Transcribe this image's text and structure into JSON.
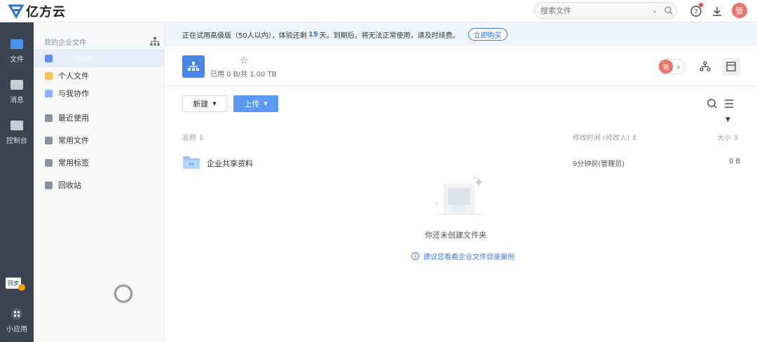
{
  "app": {
    "name": "亿方云",
    "brand_color": "#3a7be0"
  },
  "topbar": {
    "search_placeholder": "搜索文件",
    "avatar_text": "管",
    "icons": [
      "search-icon",
      "help-icon",
      "download-icon"
    ]
  },
  "rail": {
    "items": [
      {
        "label": "文件",
        "icon": "file-icon"
      },
      {
        "label": "消息",
        "icon": "message-icon"
      },
      {
        "label": "控制台",
        "icon": "console-icon"
      }
    ],
    "sync_label": "同步",
    "mini_apps_label": "小应用"
  },
  "sidebar": {
    "header": "我的企业文件",
    "items": [
      {
        "label": "个人文件",
        "icon": "personal-folder-icon"
      },
      {
        "label": "与我协作",
        "icon": "collaborate-icon"
      },
      {
        "label": "最近使用",
        "icon": "recent-icon"
      },
      {
        "label": "常用文件",
        "icon": "star-folder-icon"
      },
      {
        "label": "常用标签",
        "icon": "tag-icon"
      },
      {
        "label": "回收站",
        "icon": "trash-icon"
      }
    ]
  },
  "banner": {
    "text_before": "正在试用高级版（50人以内），体验还剩",
    "days": "15",
    "text_after": "天。到期后，将无法正常使用，请及时续费。",
    "buy_label": "立即购买"
  },
  "header": {
    "usage": "已用 0 B/共 1.00 TB",
    "manager_avatar": "管"
  },
  "toolbar": {
    "new_label": "新建",
    "upload_label": "上传"
  },
  "columns": {
    "name": "名称 ⇕",
    "modified": "修改时间 (修改人) ⇕",
    "size": "大小 ⇕"
  },
  "files": [
    {
      "name": "企业共享资料",
      "modified": "9分钟前(管理员)",
      "size": "0 B"
    }
  ],
  "empty": {
    "message": "你还未创建文件夹",
    "hint": "建议您看看企业文件目录案例"
  }
}
